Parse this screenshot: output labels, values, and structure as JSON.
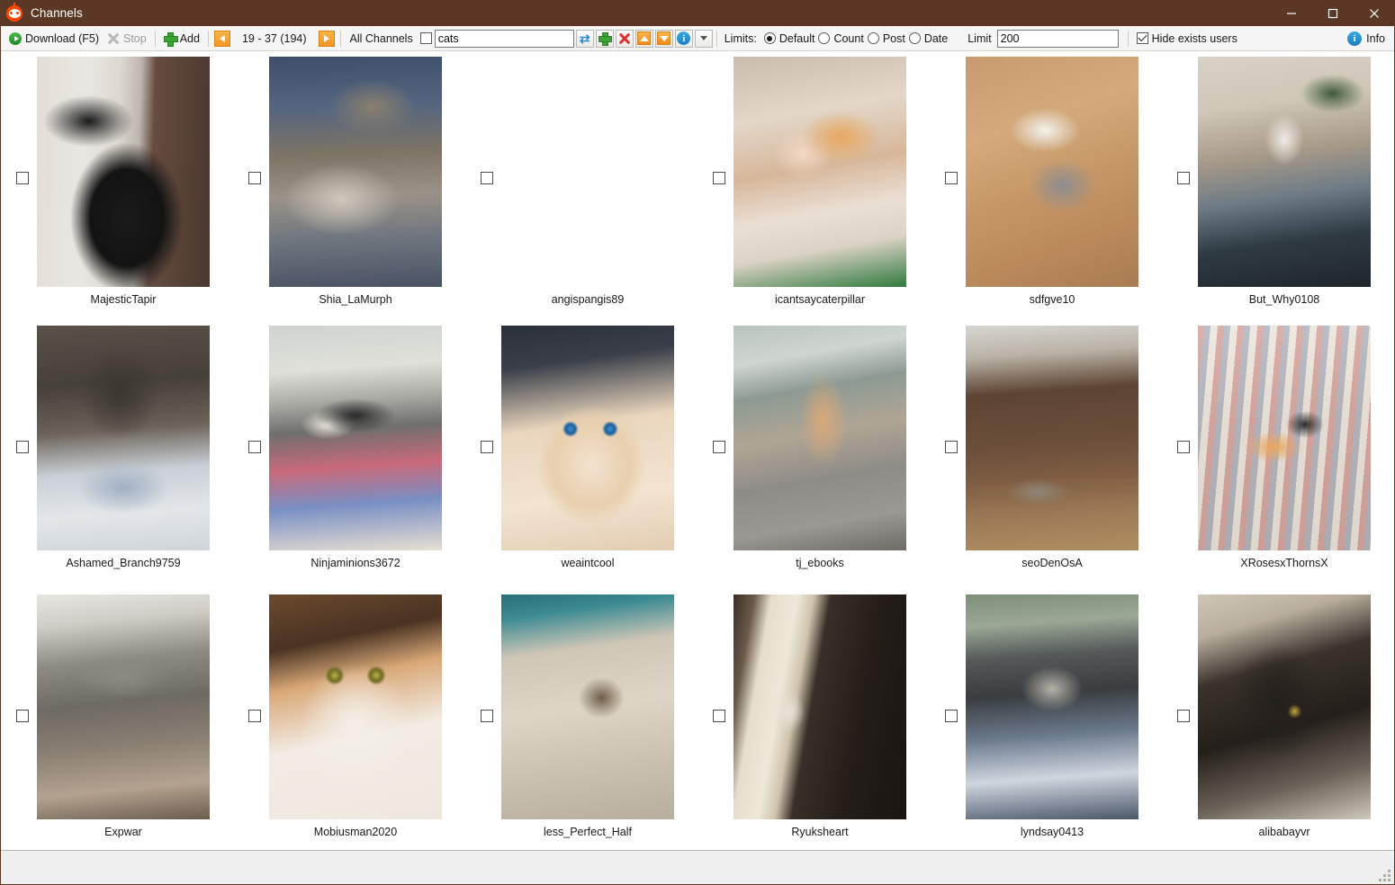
{
  "window": {
    "title": "Channels",
    "icon": "reddit-alien-icon",
    "titlebar_color": "#5a3825",
    "controls": {
      "minimize": "–",
      "maximize": "□",
      "close": "✕"
    }
  },
  "toolbar": {
    "download_label": "Download (F5)",
    "stop_label": "Stop",
    "stop_disabled": true,
    "add_label": "Add",
    "page_range": "19 - 37 (194)",
    "prev_icon": "arrow-left-icon",
    "next_icon": "arrow-right-icon",
    "all_channels_label": "All Channels",
    "all_channels_checked": false,
    "search_value": "cats",
    "search_placeholder": "",
    "buttons": [
      {
        "name": "refresh-button",
        "icon": "refresh-icon"
      },
      {
        "name": "add-channel-button",
        "icon": "plus-icon"
      },
      {
        "name": "delete-channel-button",
        "icon": "red-x-icon"
      },
      {
        "name": "move-up-button",
        "icon": "arrow-up-icon"
      },
      {
        "name": "move-down-button",
        "icon": "arrow-down-icon"
      },
      {
        "name": "channel-info-button",
        "icon": "info-icon"
      },
      {
        "name": "more-options-button",
        "icon": "chevron-down-icon"
      }
    ],
    "limits_label": "Limits:",
    "limits_options": [
      {
        "label": "Default",
        "selected": true
      },
      {
        "label": "Count",
        "selected": false
      },
      {
        "label": "Post",
        "selected": false
      },
      {
        "label": "Date",
        "selected": false
      }
    ],
    "limit_label": "Limit",
    "limit_value": "200",
    "hide_exists_label": "Hide exists users",
    "hide_exists_checked": true,
    "info_label": "Info"
  },
  "grid": {
    "columns": 6,
    "items": [
      {
        "username": "MajesticTapir",
        "checked": false
      },
      {
        "username": "Shia_LaMurph",
        "checked": false
      },
      {
        "username": "angispangis89",
        "checked": false
      },
      {
        "username": "icantsaycaterpillar",
        "checked": false
      },
      {
        "username": "sdfgve10",
        "checked": false
      },
      {
        "username": "But_Why0108",
        "checked": false
      },
      {
        "username": "Ashamed_Branch9759",
        "checked": false
      },
      {
        "username": "Ninjaminions3672",
        "checked": false
      },
      {
        "username": "weaintcool",
        "checked": false
      },
      {
        "username": "tj_ebooks",
        "checked": false
      },
      {
        "username": "seoDenOsA",
        "checked": false
      },
      {
        "username": "XRosesxThornsX",
        "checked": false
      },
      {
        "username": "Expwar",
        "checked": false
      },
      {
        "username": "Mobiusman2020",
        "checked": false
      },
      {
        "username": "less_Perfect_Half",
        "checked": false
      },
      {
        "username": "Ryuksheart",
        "checked": false
      },
      {
        "username": "lyndsay0413",
        "checked": false
      },
      {
        "username": "alibabayvr",
        "checked": false
      }
    ]
  }
}
